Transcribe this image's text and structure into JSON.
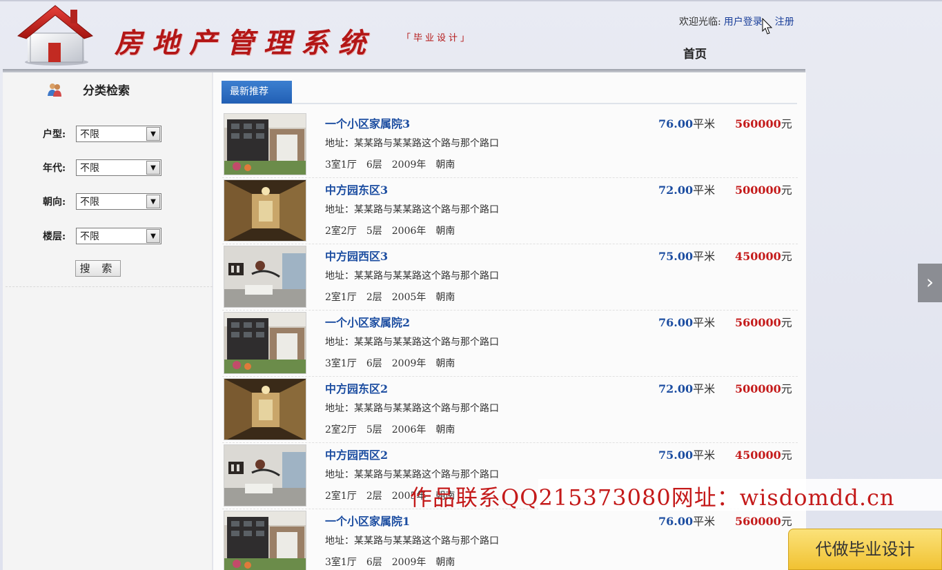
{
  "header": {
    "title": "房地产管理系统",
    "subtitle": "「毕业设计」",
    "welcome": "欢迎光临:",
    "login": "用户登录",
    "register": "注册",
    "home": "首页"
  },
  "sidebar": {
    "title": "分类检索",
    "filters": [
      {
        "label": "户型:",
        "value": "不限"
      },
      {
        "label": "年代:",
        "value": "不限"
      },
      {
        "label": "朝向:",
        "value": "不限"
      },
      {
        "label": "楼层:",
        "value": "不限"
      }
    ],
    "search_button": "搜 索"
  },
  "main": {
    "tab": "最新推荐",
    "listings": [
      {
        "title": "一个小区家属院3",
        "address": "地址：某某路与某某路这个路与那个路口",
        "rooms": "3室1厅",
        "floor": "6层",
        "year": "2009年",
        "facing": "朝南",
        "area": "76.00",
        "area_unit": "平米",
        "price": "560000",
        "price_unit": "元",
        "thumb": "building"
      },
      {
        "title": "中方园东区3",
        "address": "地址：某某路与某某路这个路与那个路口",
        "rooms": "2室2厅",
        "floor": "5层",
        "year": "2006年",
        "facing": "朝南",
        "area": "72.00",
        "area_unit": "平米",
        "price": "500000",
        "price_unit": "元",
        "thumb": "hallway"
      },
      {
        "title": "中方园西区3",
        "address": "地址：某某路与某某路这个路与那个路口",
        "rooms": "2室1厅",
        "floor": "2层",
        "year": "2005年",
        "facing": "朝南",
        "area": "75.00",
        "area_unit": "平米",
        "price": "450000",
        "price_unit": "元",
        "thumb": "room"
      },
      {
        "title": "一个小区家属院2",
        "address": "地址：某某路与某某路这个路与那个路口",
        "rooms": "3室1厅",
        "floor": "6层",
        "year": "2009年",
        "facing": "朝南",
        "area": "76.00",
        "area_unit": "平米",
        "price": "560000",
        "price_unit": "元",
        "thumb": "building"
      },
      {
        "title": "中方园东区2",
        "address": "地址：某某路与某某路这个路与那个路口",
        "rooms": "2室2厅",
        "floor": "5层",
        "year": "2006年",
        "facing": "朝南",
        "area": "72.00",
        "area_unit": "平米",
        "price": "500000",
        "price_unit": "元",
        "thumb": "hallway"
      },
      {
        "title": "中方园西区2",
        "address": "地址：某某路与某某路这个路与那个路口",
        "rooms": "2室1厅",
        "floor": "2层",
        "year": "2005年",
        "facing": "朝南",
        "area": "75.00",
        "area_unit": "平米",
        "price": "450000",
        "price_unit": "元",
        "thumb": "room"
      },
      {
        "title": "一个小区家属院1",
        "address": "地址：某某路与某某路这个路与那个路口",
        "rooms": "3室1厅",
        "floor": "6层",
        "year": "2009年",
        "facing": "朝南",
        "area": "76.00",
        "area_unit": "平米",
        "price": "560000",
        "price_unit": "元",
        "thumb": "building"
      }
    ]
  },
  "overlay": {
    "watermark": "作品联系QQ215373080网址：wisdomdd.cn",
    "side_button": "代做毕业设计",
    "next_arrow": "›"
  }
}
